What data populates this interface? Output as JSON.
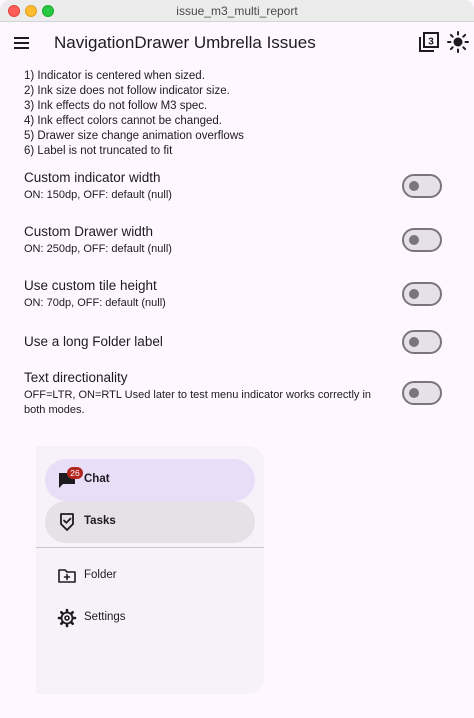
{
  "window": {
    "title": "issue_m3_multi_report"
  },
  "appbar": {
    "title": "NavigationDrawer Umbrella Issues",
    "menu_icon": "menu-icon",
    "badge_icon": "filter-3-icon",
    "badge_number": "3",
    "theme_icon": "brightness-icon"
  },
  "issues": [
    "1) Indicator is centered when sized.",
    "2) Ink size does not follow indicator size.",
    "3) Ink effects do not follow M3 spec.",
    "4) Ink effect colors cannot be changed.",
    "5) Drawer size change animation overflows",
    "6) Label is not truncated to fit"
  ],
  "settings": [
    {
      "label": "Custom indicator width",
      "desc": "ON: 150dp, OFF: default (null)",
      "on": false
    },
    {
      "label": "Custom Drawer width",
      "desc": "ON: 250dp, OFF: default (null)",
      "on": false
    },
    {
      "label": "Use custom tile height",
      "desc": "ON: 70dp, OFF: default (null)",
      "on": false
    },
    {
      "label": "Use a long Folder label",
      "desc": "",
      "on": false
    },
    {
      "label": "Text directionality",
      "desc": "OFF=LTR, ON=RTL Used later to test menu indicator works correctly in both modes.",
      "on": false
    }
  ],
  "drawer": {
    "items": [
      {
        "label": "Chat",
        "icon": "chat-icon",
        "badge": "26"
      },
      {
        "label": "Tasks",
        "icon": "task-check-icon"
      },
      {
        "label": "Folder",
        "icon": "folder-add-icon"
      },
      {
        "label": "Settings",
        "icon": "gear-icon"
      }
    ]
  },
  "colors": {
    "background": "#fef7ff",
    "drawer": "#f7f2fa",
    "indicator": "#e8def8",
    "badge": "#b3261e",
    "switch_outline": "#79747e"
  }
}
